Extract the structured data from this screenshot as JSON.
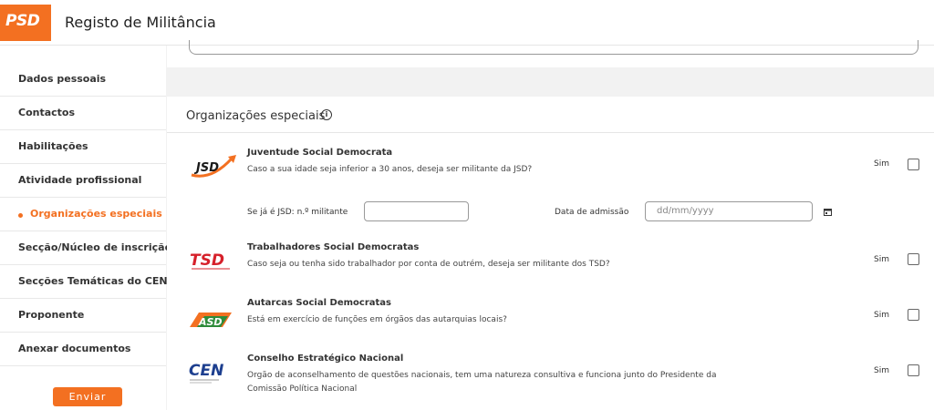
{
  "header": {
    "title": "Registo de Militância",
    "logo_text": "PSD"
  },
  "sidebar": {
    "items": [
      {
        "label": "Dados pessoais"
      },
      {
        "label": "Contactos"
      },
      {
        "label": "Habilitações"
      },
      {
        "label": "Atividade profissional"
      },
      {
        "label": "Organizações especiais",
        "active": true
      },
      {
        "label": "Secção/Núcleo de inscrição"
      },
      {
        "label": "Secções Temáticas do CEN"
      },
      {
        "label": "Proponente"
      },
      {
        "label": "Anexar documentos"
      }
    ],
    "submit_label": "Enviar"
  },
  "section": {
    "title": "Organizações especiais",
    "info_glyph": "i",
    "orgs": [
      {
        "logo_text": "JSD",
        "title": "Juventude Social Democrata",
        "description": "Caso a sua idade seja inferior a 30 anos, deseja ser militante da JSD?",
        "yes_label": "Sim"
      },
      {
        "logo_text": "TSD",
        "title": "Trabalhadores Social Democratas",
        "description": "Caso seja ou tenha sido trabalhador por conta de outrém, deseja ser militante dos TSD?",
        "yes_label": "Sim"
      },
      {
        "logo_text": "ASD",
        "title": "Autarcas Social Democratas",
        "description": "Está em exercício de funções em órgãos das autarquias locais?",
        "yes_label": "Sim"
      },
      {
        "logo_text": "CEN",
        "title": "Conselho Estratégico Nacional",
        "description": "Orgão de aconselhamento de questões nacionais, tem uma natureza consultiva e funciona junto do Presidente da Comissão Política Nacional",
        "yes_label": "Sim"
      }
    ],
    "jsd_fields": {
      "member_number_label": "Se já é JSD: n.º militante",
      "member_number_value": "",
      "admission_date_label": "Data de admissão",
      "admission_date_placeholder": "dd/mm/yyyy"
    }
  },
  "colors": {
    "accent": "#f37021",
    "cen_blue": "#1d3f8f",
    "jsd_green": "#2e8b3a",
    "tsd_red": "#d6202a"
  }
}
